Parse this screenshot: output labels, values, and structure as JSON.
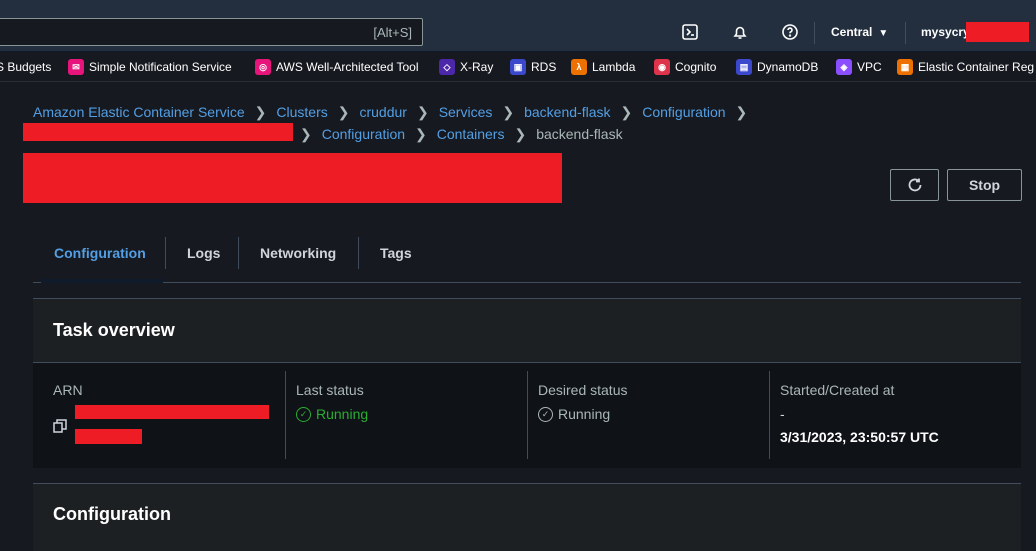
{
  "topbar": {
    "search_shortcut": "[Alt+S]",
    "region_label": "Central",
    "region_caret": "▼",
    "account_label": "mysycry",
    "icons": [
      "cloudshell-icon",
      "bell-icon",
      "help-icon"
    ]
  },
  "favorites": [
    {
      "label": "S Budgets",
      "color": "#16191f",
      "icon": ""
    },
    {
      "label": "Simple Notification Service",
      "color": "#e7157b",
      "icon": "✉"
    },
    {
      "label": "AWS Well-Architected Tool",
      "color": "#e7157b",
      "icon": "◎"
    },
    {
      "label": "X-Ray",
      "color": "#4d27aa",
      "icon": "◇"
    },
    {
      "label": "RDS",
      "color": "#3b48cc",
      "icon": "▣"
    },
    {
      "label": "Lambda",
      "color": "#ed7100",
      "icon": "λ"
    },
    {
      "label": "Cognito",
      "color": "#dd344c",
      "icon": "◉"
    },
    {
      "label": "DynamoDB",
      "color": "#3b48cc",
      "icon": "▤"
    },
    {
      "label": "VPC",
      "color": "#8c4fff",
      "icon": "◈"
    },
    {
      "label": "Elastic Container Reg",
      "color": "#ed7100",
      "icon": "▦"
    }
  ],
  "breadcrumb": {
    "row1": [
      "Amazon Elastic Container Service",
      "Clusters",
      "cruddur",
      "Services",
      "backend-flask",
      "Configuration"
    ],
    "row2_links": [
      "Configuration",
      "Containers"
    ],
    "current": "backend-flask"
  },
  "header": {
    "stop_label": "Stop"
  },
  "tabs": [
    "Configuration",
    "Logs",
    "Networking",
    "Tags"
  ],
  "task_overview": {
    "title": "Task overview",
    "arn_label": "ARN",
    "last_status_label": "Last status",
    "last_status_value": "Running",
    "desired_status_label": "Desired status",
    "desired_status_value": "Running",
    "started_label": "Started/Created at",
    "started_dash": "-",
    "started_value": "3/31/2023, 23:50:57 UTC"
  },
  "configuration": {
    "title": "Configuration"
  },
  "colors": {
    "accent_link": "#539fe5",
    "status_running": "#29ad32",
    "redaction": "#ee1c25"
  }
}
